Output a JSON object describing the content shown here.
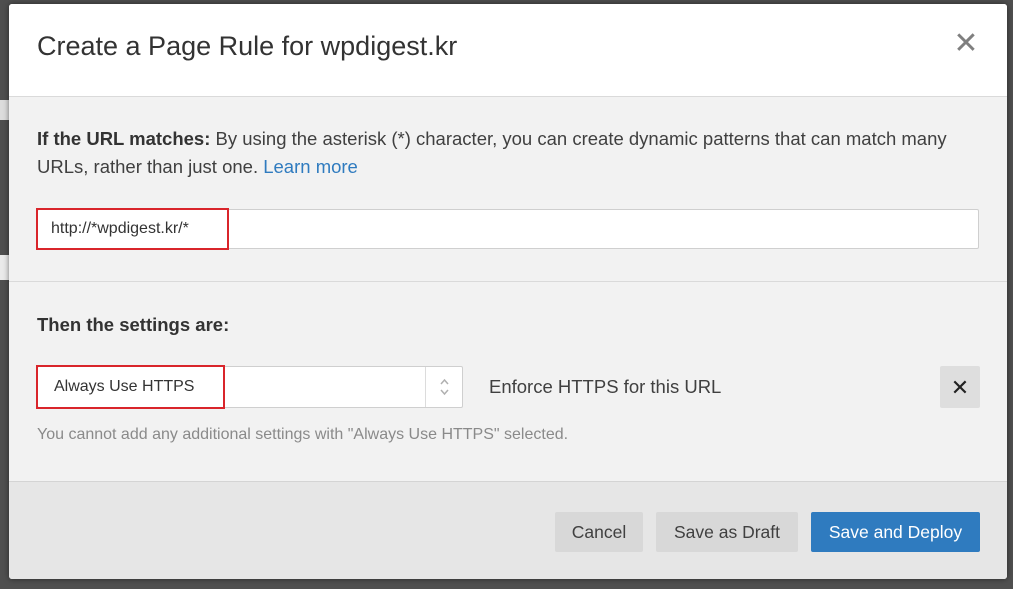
{
  "modal": {
    "title": "Create a Page Rule for wpdigest.kr",
    "close_label": "✕"
  },
  "url_section": {
    "label": "If the URL matches:",
    "description": " By using the asterisk (*) character, you can create dynamic patterns that can match many URLs, rather than just one. ",
    "learn_more": "Learn more",
    "url_value": "http://*wpdigest.kr/*"
  },
  "settings_section": {
    "heading": "Then the settings are:",
    "selected_setting": "Always Use HTTPS",
    "setting_description": "Enforce HTTPS for this URL",
    "remove_label": "✕",
    "note": "You cannot add any additional settings with \"Always Use HTTPS\" selected."
  },
  "footer": {
    "cancel_label": "Cancel",
    "save_draft_label": "Save as Draft",
    "save_deploy_label": "Save and Deploy"
  },
  "colors": {
    "primary": "#2f7bbf",
    "highlight": "#d9252b",
    "link": "#2f7bbf"
  },
  "icons": {
    "close": "close-icon",
    "select_arrows": "select-arrows-icon",
    "remove": "remove-icon"
  }
}
